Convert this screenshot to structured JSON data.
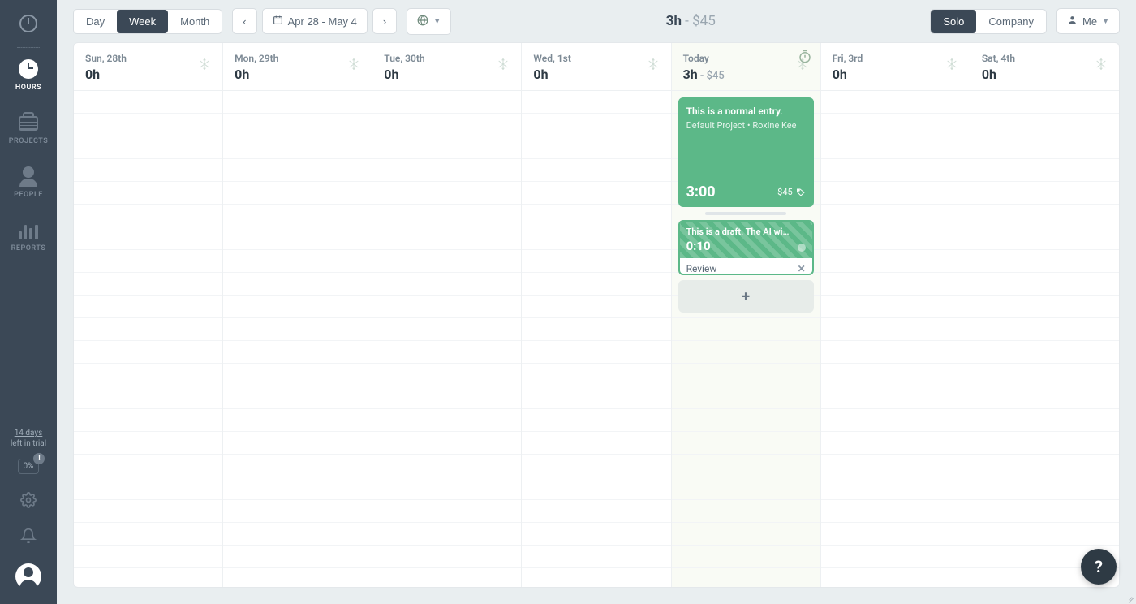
{
  "sidebar": {
    "items": [
      {
        "label": "HOURS"
      },
      {
        "label": "PROJECTS"
      },
      {
        "label": "PEOPLE"
      },
      {
        "label": "REPORTS"
      }
    ],
    "trial_line1": "14 days",
    "trial_line2": "left in trial",
    "percent": "0%",
    "percent_badge": "!"
  },
  "toolbar": {
    "view": {
      "day": "Day",
      "week": "Week",
      "month": "Month"
    },
    "date_range": "Apr 28 - May 4",
    "globe_label": "",
    "summary": {
      "hours": "3h",
      "sep": " - ",
      "amount": "$45"
    },
    "scope": {
      "solo": "Solo",
      "company": "Company"
    },
    "me": "Me"
  },
  "days": [
    {
      "label": "Sun, 28th",
      "hours": "0h",
      "sub": "",
      "today": false
    },
    {
      "label": "Mon, 29th",
      "hours": "0h",
      "sub": "",
      "today": false
    },
    {
      "label": "Tue, 30th",
      "hours": "0h",
      "sub": "",
      "today": false
    },
    {
      "label": "Wed, 1st",
      "hours": "0h",
      "sub": "",
      "today": false
    },
    {
      "label": "Today",
      "hours": "3h",
      "sub": " - $45",
      "today": true
    },
    {
      "label": "Fri, 3rd",
      "hours": "0h",
      "sub": "",
      "today": false
    },
    {
      "label": "Sat, 4th",
      "hours": "0h",
      "sub": "",
      "today": false
    }
  ],
  "entries": {
    "normal": {
      "title": "This is a normal entry.",
      "project": "Default Project",
      "person": "Roxine Kee",
      "duration": "3:00",
      "amount": "$45"
    },
    "draft": {
      "title": "This is a draft. The AI wi…",
      "duration": "0:10",
      "review": "Review"
    }
  },
  "help": "?"
}
